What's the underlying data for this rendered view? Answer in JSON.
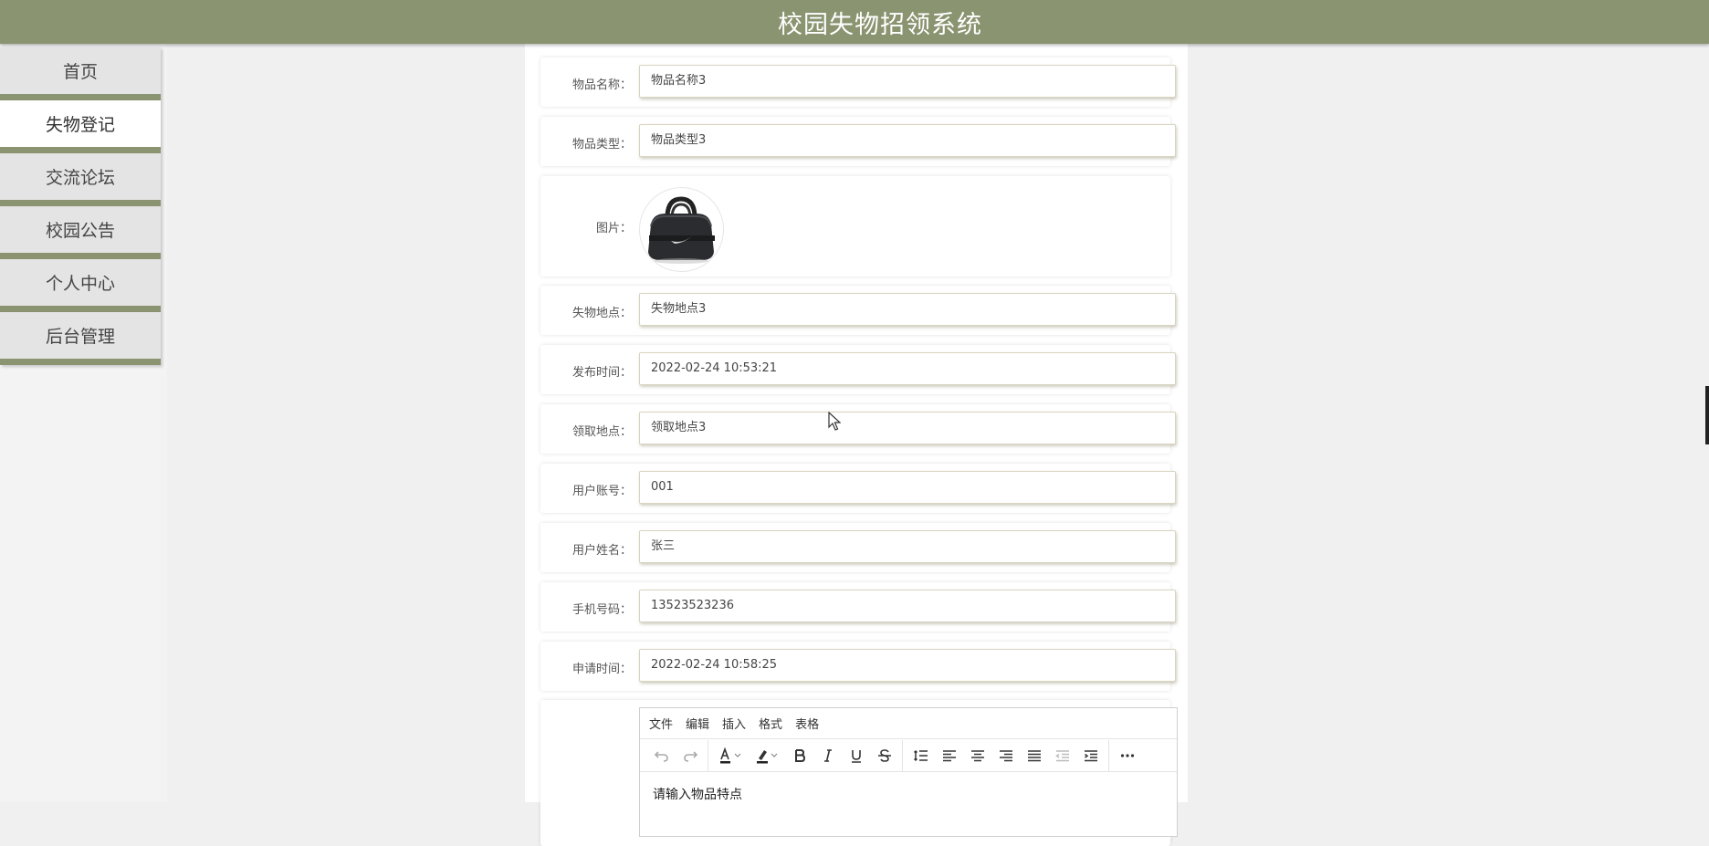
{
  "header": {
    "title": "校园失物招领系统"
  },
  "sidebar": {
    "items": [
      {
        "label": "首页"
      },
      {
        "label": "失物登记"
      },
      {
        "label": "交流论坛"
      },
      {
        "label": "校园公告"
      },
      {
        "label": "个人中心"
      },
      {
        "label": "后台管理"
      }
    ],
    "active_index": 1
  },
  "form": {
    "item_name": {
      "label": "物品名称：",
      "value": "物品名称3"
    },
    "item_type": {
      "label": "物品类型：",
      "value": "物品类型3"
    },
    "image": {
      "label": "图片："
    },
    "lost_place": {
      "label": "失物地点：",
      "value": "失物地点3"
    },
    "publish_time": {
      "label": "发布时间：",
      "value": "2022-02-24 10:53:21"
    },
    "claim_place": {
      "label": "领取地点：",
      "value": "领取地点3"
    },
    "user_account": {
      "label": "用户账号：",
      "value": "001"
    },
    "user_name": {
      "label": "用户姓名：",
      "value": "张三"
    },
    "phone": {
      "label": "手机号码：",
      "value": "13523523236"
    },
    "apply_time": {
      "label": "申请时间：",
      "value": "2022-02-24 10:58:25"
    }
  },
  "editor": {
    "menus": [
      "文件",
      "编辑",
      "插入",
      "格式",
      "表格"
    ],
    "placeholder": "请输入物品特点"
  },
  "colors": {
    "accent": "#8a9470",
    "background": "#f0f0f0"
  }
}
